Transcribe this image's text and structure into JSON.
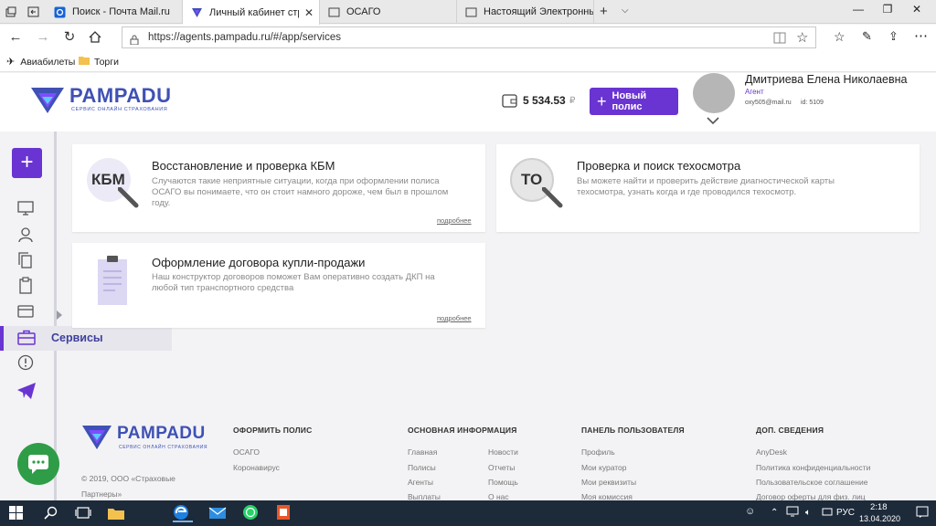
{
  "browser": {
    "tabs": [
      {
        "title": "Поиск - Почта Mail.ru",
        "icon": "mail-icon",
        "active": false
      },
      {
        "title": "Личный кабинет страх",
        "icon": "pampadu-favicon-icon",
        "active": true
      },
      {
        "title": "ОСАГО",
        "icon": "page-icon",
        "active": false
      },
      {
        "title": "Настоящий Электронный Г",
        "icon": "page-icon",
        "active": false
      }
    ],
    "url": "https://agents.pampadu.ru/#/app/services",
    "favorites": [
      {
        "label": "Авиабилеты",
        "icon": "airplane-icon"
      },
      {
        "label": "Торги",
        "icon": "folder-icon"
      }
    ]
  },
  "header": {
    "logo": "PAMPADU",
    "logo_tagline": "СЕРВИС ОНЛАЙН СТРАХОВАНИЯ",
    "balance": "5 534.53",
    "currency": "₽",
    "new_policy_label": "Новый полис",
    "user": {
      "name": "Дмитриева Елена Николаевна",
      "role": "Агент",
      "email": "oxy505@mail.ru",
      "id": "id: 5109"
    }
  },
  "sidebar": {
    "active_label": "Сервисы",
    "accent": "#6a34d2"
  },
  "cards": [
    {
      "badge": "КБМ",
      "title": "Восстановление и проверка КБМ",
      "desc_lines": [
        "Случаются такие неприятные ситуации, когда при оформлении полиса",
        "ОСАГО вы понимаете, что он стоит намного дороже, чем был в прошлом",
        "году."
      ],
      "more": "подробнее"
    },
    {
      "badge": "ТО",
      "title": "Проверка и поиск техосмотра",
      "desc_lines": [
        "Вы можете найти и проверить действие диагностической карты",
        "техосмотра, узнать когда и где проводился техосмотр."
      ],
      "more": ""
    },
    {
      "badge": "",
      "title": "Оформление договора купли-продажи",
      "desc_lines": [
        "Наш конструктор договоров поможет Вам оперативно создать ДКП на",
        "любой тип транспортного средства"
      ],
      "more": "подробнее"
    }
  ],
  "footer": {
    "copyright_lines": [
      "© 2019, ООО «Страховые",
      "Партнеры»"
    ],
    "columns": [
      {
        "heading": "ОФОРМИТЬ ПОЛИС",
        "links": [
          "ОСАГО",
          "Коронавирус"
        ]
      },
      {
        "heading": "ОСНОВНАЯ ИНФОРМАЦИЯ",
        "links": [
          "Главная",
          "Полисы",
          "Агенты",
          "Выплаты"
        ],
        "links2": [
          "Новости",
          "Отчеты",
          "Помощь",
          "О нас"
        ]
      },
      {
        "heading": "ПАНЕЛЬ ПОЛЬЗОВАТЕЛЯ",
        "links": [
          "Профиль",
          "Мои куратор",
          "Мои реквизиты",
          "Моя комиссия"
        ]
      },
      {
        "heading": "ДОП. СВЕДЕНИЯ",
        "links": [
          "AnyDesk",
          "Политика конфиденциальности",
          "Пользовательское соглашение",
          "Договор оферты для физ. лиц"
        ]
      }
    ]
  },
  "taskbar": {
    "lang": "РУС",
    "time": "2:18",
    "date": "13.04.2020"
  }
}
